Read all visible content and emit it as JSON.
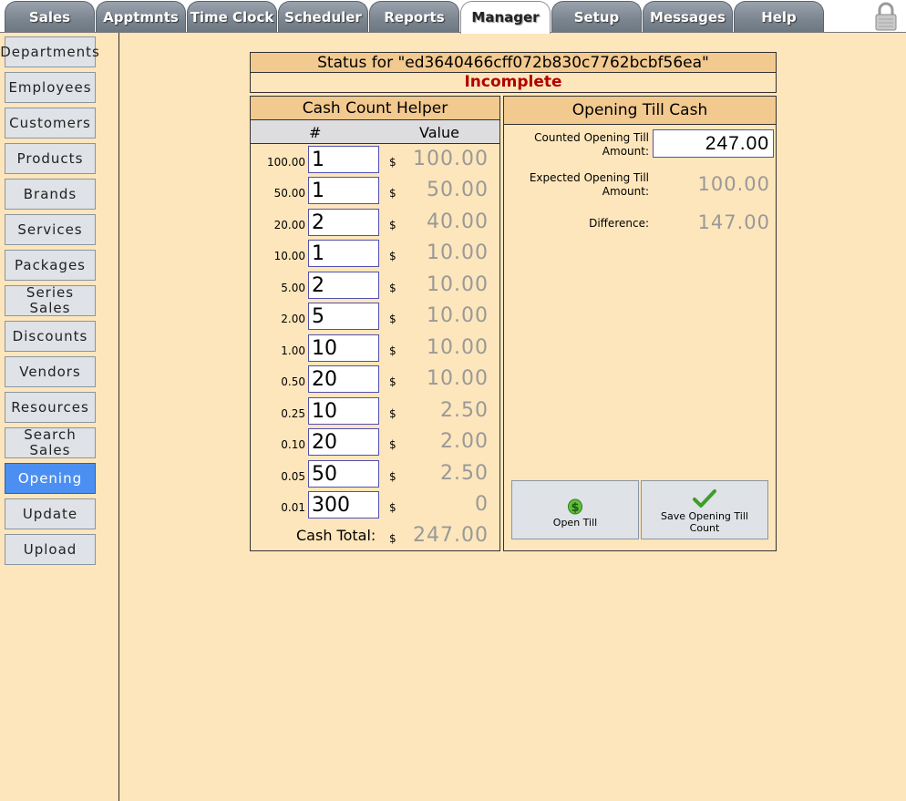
{
  "tabs": [
    {
      "label": "Sales",
      "active": false
    },
    {
      "label": "Apptmnts",
      "active": false
    },
    {
      "label": "Time Clock",
      "active": false
    },
    {
      "label": "Scheduler",
      "active": false
    },
    {
      "label": "Reports",
      "active": false
    },
    {
      "label": "Manager",
      "active": true
    },
    {
      "label": "Setup",
      "active": false
    },
    {
      "label": "Messages",
      "active": false
    },
    {
      "label": "Help",
      "active": false
    }
  ],
  "sidebar": {
    "items": [
      {
        "label": "Departments",
        "active": false
      },
      {
        "label": "Employees",
        "active": false
      },
      {
        "label": "Customers",
        "active": false
      },
      {
        "label": "Products",
        "active": false
      },
      {
        "label": "Brands",
        "active": false
      },
      {
        "label": "Services",
        "active": false
      },
      {
        "label": "Packages",
        "active": false
      },
      {
        "label": "Series Sales",
        "active": false
      },
      {
        "label": "Discounts",
        "active": false
      },
      {
        "label": "Vendors",
        "active": false
      },
      {
        "label": "Resources",
        "active": false
      },
      {
        "label": "Search Sales",
        "active": false
      },
      {
        "label": "Opening",
        "active": true
      },
      {
        "label": "Update",
        "active": false
      },
      {
        "label": "Upload",
        "active": false
      }
    ]
  },
  "status": {
    "title": "Status for \"ed3640466cff072b830c7762bcbf56ea\"",
    "state": "Incomplete"
  },
  "cash_helper": {
    "title": "Cash Count Helper",
    "col_qty": "#",
    "col_value": "Value",
    "currency": "$",
    "rows": [
      {
        "denom": "100.00",
        "qty": "1",
        "value": "100.00"
      },
      {
        "denom": "50.00",
        "qty": "1",
        "value": "50.00"
      },
      {
        "denom": "20.00",
        "qty": "2",
        "value": "40.00"
      },
      {
        "denom": "10.00",
        "qty": "1",
        "value": "10.00"
      },
      {
        "denom": "5.00",
        "qty": "2",
        "value": "10.00"
      },
      {
        "denom": "2.00",
        "qty": "5",
        "value": "10.00"
      },
      {
        "denom": "1.00",
        "qty": "10",
        "value": "10.00"
      },
      {
        "denom": "0.50",
        "qty": "20",
        "value": "10.00"
      },
      {
        "denom": "0.25",
        "qty": "10",
        "value": "2.50"
      },
      {
        "denom": "0.10",
        "qty": "20",
        "value": "2.00"
      },
      {
        "denom": "0.05",
        "qty": "50",
        "value": "2.50"
      },
      {
        "denom": "0.01",
        "qty": "300",
        "value": "0"
      }
    ],
    "total_label": "Cash Total:",
    "total_value": "247.00"
  },
  "opening_till": {
    "title": "Opening Till Cash",
    "counted_label": "Counted Opening Till Amount:",
    "counted_value": "247.00",
    "expected_label": "Expected Opening Till Amount:",
    "expected_value": "100.00",
    "difference_label": "Difference:",
    "difference_value": "147.00",
    "open_till_label": "Open Till",
    "save_label": "Save Opening Till Count"
  },
  "colors": {
    "background": "#fde6bb",
    "header": "#f2c98f",
    "status_incomplete": "#b20000",
    "active_sidebar": "#4c8ff2"
  },
  "icons": {
    "lock": "lock-icon",
    "open_till": "dollar-icon",
    "save": "checkmark-icon"
  }
}
